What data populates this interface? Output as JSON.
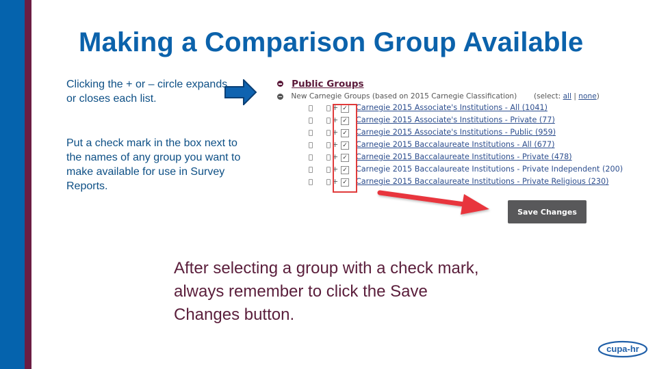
{
  "slide": {
    "title": "Making a Comparison Group Available",
    "instruction_1": "Clicking the + or – circle expands or closes each list.",
    "instruction_2": "Put a check mark in the box next to the names of any group you want to make available for use in Survey Reports.",
    "reminder": "After selecting a group with a check mark, always remember to click the Save Changes button.",
    "logo_text": "cupa-hr",
    "colors": {
      "title": "#0b62ab",
      "stripe_blue": "#0563ad",
      "stripe_maroon": "#6b1d43",
      "highlight_red": "#e03a3a"
    }
  },
  "ui": {
    "public_groups_label": "Public Groups",
    "new_carnegie_label": "New Carnegie Groups (based on 2015 Carnegie Classification)",
    "select_prefix": "(select:",
    "select_all": "all",
    "select_sep": "|",
    "select_none": "none",
    "select_suffix": ")",
    "items": [
      {
        "label": "Carnegie 2015 Associate's Institutions - All (1041)",
        "checked": true
      },
      {
        "label": "Carnegie 2015 Associate's Institutions - Private (77)",
        "checked": true
      },
      {
        "label": "Carnegie 2015 Associate's Institutions - Public (959)",
        "checked": true
      },
      {
        "label": "Carnegie 2015 Baccalaureate Institutions - All (677)",
        "checked": true
      },
      {
        "label": "Carnegie 2015 Baccalaureate Institutions - Private (478)",
        "checked": true
      },
      {
        "label": "Carnegie 2015 Baccalaureate Institutions - Private Independent (200)",
        "checked": true
      },
      {
        "label": "Carnegie 2015 Baccalaureate Institutions - Private Religious (230)",
        "checked": true
      }
    ],
    "check_glyph": "✓",
    "plus_glyph": "+",
    "save_button_label": "Save Changes"
  }
}
